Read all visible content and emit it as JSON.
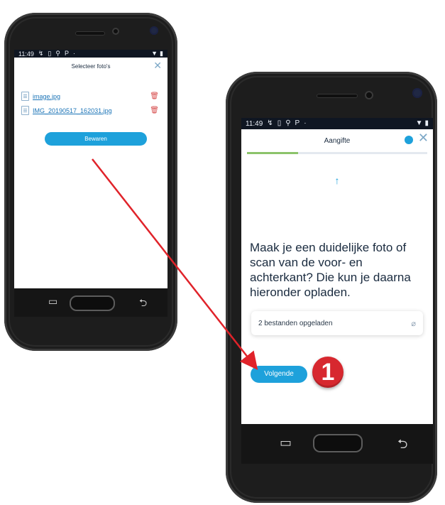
{
  "left_screen": {
    "status": {
      "time": "11:49",
      "left_icons": [
        "↯",
        "▯",
        "⚲",
        "Ρ",
        "·"
      ],
      "right_icons": [
        "▼",
        "▮"
      ]
    },
    "title": "Selecteer foto's",
    "files": [
      {
        "name": "image.jpg"
      },
      {
        "name": "IMG_20190517_162031.jpg"
      }
    ],
    "save_label": "Bewaren",
    "close_icon": "close-icon",
    "file_icon": "file-icon",
    "trash_icon": "trash-icon",
    "nav": {
      "recent": "▭",
      "back": "⮌"
    }
  },
  "right_screen": {
    "status": {
      "time": "11:49",
      "left_icons": [
        "↯",
        "▯",
        "⚲",
        "Ρ",
        "·"
      ],
      "right_icons": [
        "▼",
        "▮"
      ]
    },
    "title": "Aangifte",
    "progress": {
      "fraction": 0.28
    },
    "up_arrow": "↑",
    "instruction": "Maak je een duidelijke foto of scan van de voor- en achterkant? Die kun je daarna hieronder opladen.",
    "uploads_text": "2 bestanden opgeladen",
    "edit_icon": "edit-icon",
    "next_label": "Volgende",
    "nav": {
      "recent": "▭",
      "back": "⮌"
    }
  },
  "annotation": {
    "badge": "1",
    "color": "#d7282f"
  },
  "colors": {
    "accent": "#1ea1db",
    "link": "#1b74b7",
    "progress": "#8cc36a",
    "status_bar": "#0f1622"
  }
}
